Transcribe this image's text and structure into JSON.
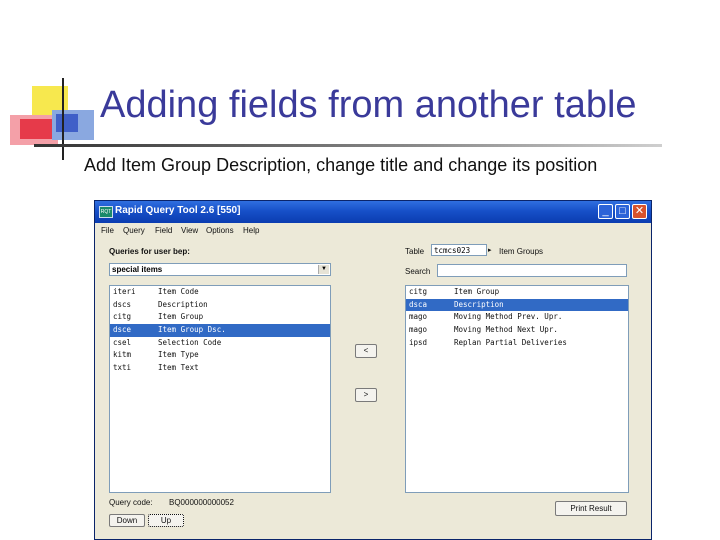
{
  "slide": {
    "title": "Adding fields from another table",
    "subtitle": "Add Item Group Description, change title and change its position"
  },
  "window": {
    "title": "Rapid Query Tool 2.6 [550]",
    "icon_text": "RQT",
    "buttons": {
      "minimize": "_",
      "maximize": "□",
      "close": "✕"
    }
  },
  "menu": [
    "File",
    "Query",
    "Field",
    "View",
    "Options",
    "Help"
  ],
  "left": {
    "queries_label": "Queries for user bep:",
    "query_select": "special items",
    "fields": [
      {
        "code": "iteri",
        "name": "Item Code"
      },
      {
        "code": "dscs",
        "name": "Description"
      },
      {
        "code": "citg",
        "name": "Item Group"
      },
      {
        "code": "dsce",
        "name": "Item Group Dsc."
      },
      {
        "code": "csel",
        "name": "Selection Code"
      },
      {
        "code": "kitm",
        "name": "Item Type"
      },
      {
        "code": "txti",
        "name": "Item Text"
      }
    ],
    "selected_index": 3,
    "query_code_label": "Query code:",
    "query_code_value": "BQ000000000052",
    "down_label": "Down",
    "up_label": "Up"
  },
  "middle": {
    "remove_label": "<",
    "add_label": ">"
  },
  "right": {
    "table_label": "Table",
    "table_value": "tcmcs023",
    "table_arrow": "▸",
    "table_desc": "Item Groups",
    "search_label": "Search",
    "search_value": "",
    "fields": [
      {
        "code": "citg",
        "name": "Item Group"
      },
      {
        "code": "dsca",
        "name": "Description"
      },
      {
        "code": "mago",
        "name": "Moving Method Prev. Upr."
      },
      {
        "code": "mago",
        "name": "Moving Method Next Upr."
      },
      {
        "code": "ipsd",
        "name": "Replan Partial Deliveries"
      }
    ],
    "selected_index": 1,
    "print_label": "Print Result"
  }
}
